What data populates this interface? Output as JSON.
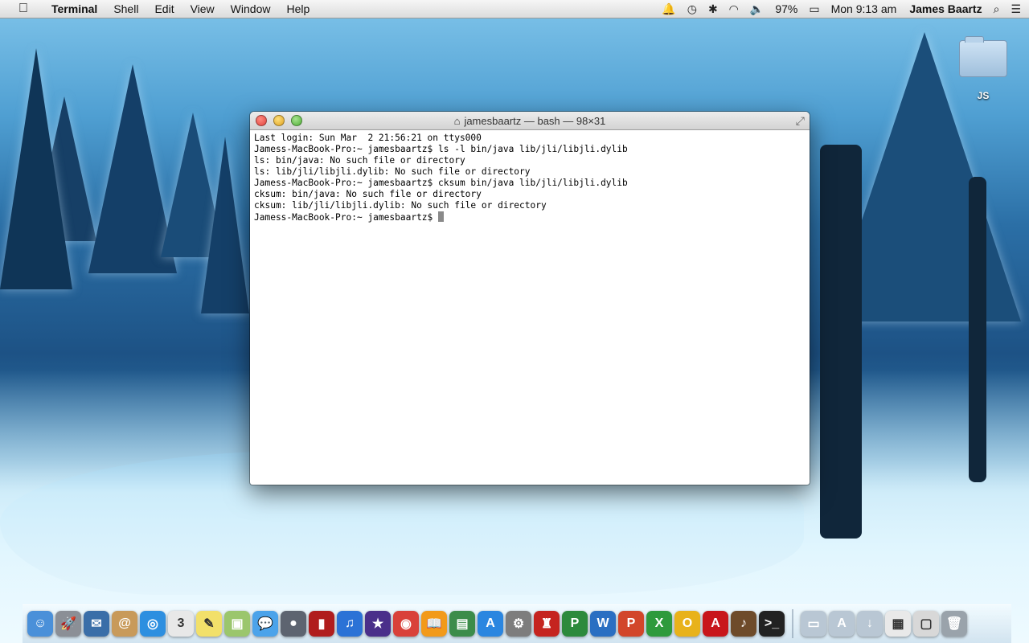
{
  "menubar": {
    "apple_icon": "apple-icon",
    "app_name": "Terminal",
    "menus": [
      "Shell",
      "Edit",
      "View",
      "Window",
      "Help"
    ],
    "battery": "97%",
    "clock": "Mon 9:13 am",
    "user": "James Baartz"
  },
  "desktop": {
    "icon_label": "JS"
  },
  "terminal": {
    "title": "jamesbaartz — bash — 98×31",
    "lines": [
      "Last login: Sun Mar  2 21:56:21 on ttys000",
      "Jamess-MacBook-Pro:~ jamesbaartz$ ls -l bin/java lib/jli/libjli.dylib",
      "ls: bin/java: No such file or directory",
      "ls: lib/jli/libjli.dylib: No such file or directory",
      "Jamess-MacBook-Pro:~ jamesbaartz$ cksum bin/java lib/jli/libjli.dylib",
      "cksum: bin/java: No such file or directory",
      "cksum: lib/jli/libjli.dylib: No such file or directory",
      "Jamess-MacBook-Pro:~ jamesbaartz$ "
    ]
  },
  "dock": {
    "apps": [
      {
        "name": "finder-icon",
        "glyph": "☺",
        "color": "#4a90d9"
      },
      {
        "name": "launchpad-icon",
        "glyph": "🚀",
        "color": "#8b8f96"
      },
      {
        "name": "mail-stamp-icon",
        "glyph": "✉",
        "color": "#3a6ea8"
      },
      {
        "name": "contacts-icon",
        "glyph": "@",
        "color": "#c89a5a"
      },
      {
        "name": "safari-icon",
        "glyph": "◎",
        "color": "#2d8fe0"
      },
      {
        "name": "calendar-icon",
        "glyph": "3",
        "color": "#e8e8e8"
      },
      {
        "name": "stickies-icon",
        "glyph": "✎",
        "color": "#f2e06a"
      },
      {
        "name": "photos-icon",
        "glyph": "▣",
        "color": "#9bc66d"
      },
      {
        "name": "messages-icon",
        "glyph": "💬",
        "color": "#4ba3ea"
      },
      {
        "name": "facetime-icon",
        "glyph": "●",
        "color": "#5d6470"
      },
      {
        "name": "photo-booth-icon",
        "glyph": "▮",
        "color": "#b01d1d"
      },
      {
        "name": "itunes-icon",
        "glyph": "♫",
        "color": "#2b72d6"
      },
      {
        "name": "imovie-icon",
        "glyph": "★",
        "color": "#4a2f8a"
      },
      {
        "name": "chrome-icon",
        "glyph": "◉",
        "color": "#d9413a"
      },
      {
        "name": "ibooks-icon",
        "glyph": "📖",
        "color": "#f29a1a"
      },
      {
        "name": "iphoto-icon",
        "glyph": "▤",
        "color": "#3c8c4a"
      },
      {
        "name": "app-store-icon",
        "glyph": "A",
        "color": "#2a86e0"
      },
      {
        "name": "system-preferences-icon",
        "glyph": "⚙",
        "color": "#7d7d7d"
      },
      {
        "name": "game-icon",
        "glyph": "♜",
        "color": "#c5241f"
      },
      {
        "name": "project-icon",
        "glyph": "P",
        "color": "#2d8a3c"
      },
      {
        "name": "word-icon",
        "glyph": "W",
        "color": "#2a6fc2"
      },
      {
        "name": "powerpoint-icon",
        "glyph": "P",
        "color": "#d2462a"
      },
      {
        "name": "excel-icon",
        "glyph": "X",
        "color": "#2e9a3c"
      },
      {
        "name": "outlook-icon",
        "glyph": "O",
        "color": "#e8b21a"
      },
      {
        "name": "acrobat-icon",
        "glyph": "A",
        "color": "#c8161b"
      },
      {
        "name": "garageband-icon",
        "glyph": "♪",
        "color": "#6e4b2a"
      },
      {
        "name": "terminal-icon",
        "glyph": ">_",
        "color": "#222"
      }
    ],
    "trailing": [
      {
        "name": "documents-stack-icon",
        "glyph": "▭",
        "color": "#b9c7d4"
      },
      {
        "name": "applications-stack-icon",
        "glyph": "A",
        "color": "#b9c7d4"
      },
      {
        "name": "downloads-stack-icon",
        "glyph": "↓",
        "color": "#b9c7d4"
      },
      {
        "name": "screenshot-stack-icon",
        "glyph": "▦",
        "color": "#e9e9e9"
      },
      {
        "name": "window-stack-icon",
        "glyph": "▢",
        "color": "#d8d8d8"
      },
      {
        "name": "trash-icon",
        "glyph": "🗑",
        "color": "#9aa3ab"
      }
    ]
  }
}
